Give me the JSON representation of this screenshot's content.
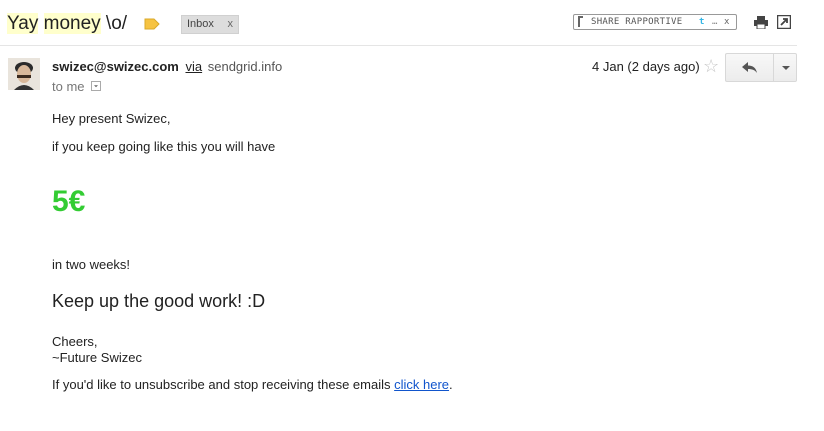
{
  "subject": {
    "parts": [
      {
        "text": "Yay",
        "highlight": true
      },
      {
        "text": " ",
        "highlight": false
      },
      {
        "text": "money",
        "highlight": true
      },
      {
        "text": " \\o/",
        "highlight": false
      }
    ]
  },
  "labels": {
    "inbox": "Inbox",
    "remove": "x"
  },
  "rapportive": {
    "text": "SHARE RAPPORTIVE",
    "more": "…",
    "close": "x"
  },
  "message": {
    "sender_email": "swizec@swizec.com",
    "via": "via",
    "via_domain": "sendgrid.info",
    "to": "to me",
    "date": "4 Jan (2 days ago)",
    "star": "☆"
  },
  "body": {
    "greeting": "Hey present Swizec,",
    "line1": "if you keep going like this you will have",
    "amount": "5€",
    "line2": "in two weeks!",
    "keep_up": "Keep up the good work! :D",
    "cheers": "Cheers,",
    "signature": "~Future Swizec",
    "unsubscribe_text": "If you'd like to unsubscribe and stop receiving these emails ",
    "unsubscribe_link": "click here",
    "unsubscribe_end": "."
  },
  "colors": {
    "amount_green": "#33cc33",
    "link_blue": "#1155cc",
    "subject_highlight": "#ffffcc",
    "label_yellow": "#f6c342"
  },
  "icons": [
    "label-icon",
    "print-icon",
    "new-window-icon",
    "star-icon",
    "reply-icon",
    "chevron-down-icon",
    "twitter-icon",
    "rapportive-logo-icon"
  ]
}
